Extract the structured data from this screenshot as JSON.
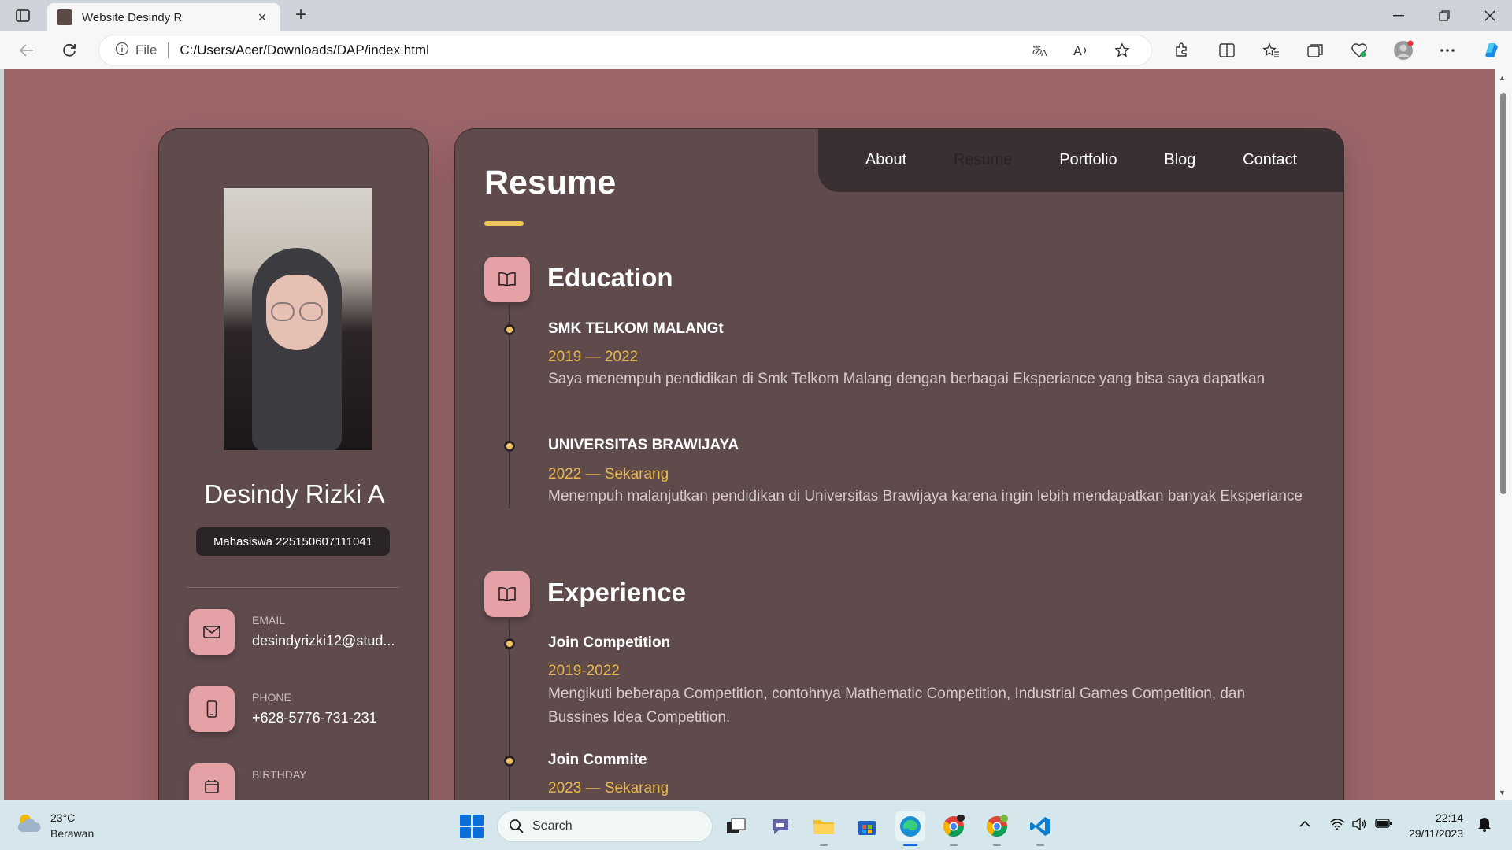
{
  "browser": {
    "tab_title": "Website Desindy R",
    "new_tab_glyph": "+",
    "close_glyph": "×",
    "address_prefix": "File",
    "url": "C:/Users/Acer/Downloads/DAP/index.html",
    "icons": [
      "sidebar-toggle-icon",
      "back-icon",
      "refresh-icon",
      "info-icon",
      "translate-icon",
      "read-aloud-icon",
      "favorite-star-icon",
      "extensions-icon",
      "split-screen-icon",
      "favorites-icon",
      "collections-icon",
      "browser-essentials-icon",
      "profile-icon",
      "more-icon",
      "copilot-icon"
    ]
  },
  "sidebar": {
    "name": "Desindy Rizki A",
    "title": "Mahasiswa 225150607111041",
    "contacts": [
      {
        "label": "EMAIL",
        "value": "desindyrizki12@stud...",
        "icon": "mail-icon"
      },
      {
        "label": "PHONE",
        "value": "+628-5776-731-231",
        "icon": "phone-icon"
      },
      {
        "label": "BIRTHDAY",
        "value": "",
        "icon": "calendar-icon"
      }
    ]
  },
  "nav": {
    "items": [
      "About",
      "Resume",
      "Portfolio",
      "Blog",
      "Contact"
    ],
    "active": "Resume"
  },
  "resume": {
    "title": "Resume",
    "education": {
      "title": "Education",
      "items": [
        {
          "title": "SMK TELKOM MALANGt",
          "date": "2019 — 2022",
          "desc": "Saya menempuh pendidikan di Smk Telkom Malang dengan berbagai Eksperiance yang bisa saya dapatkan"
        },
        {
          "title": "UNIVERSITAS BRAWIJAYA",
          "date": "2022 — Sekarang",
          "desc": "Menempuh malanjutkan pendidikan di Universitas Brawijaya karena ingin lebih mendapatkan banyak Eksperiance"
        }
      ]
    },
    "experience": {
      "title": "Experience",
      "items": [
        {
          "title": "Join Competition",
          "date": "2019-2022",
          "desc": "Mengikuti beberapa Competition, contohnya Mathematic Competition, Industrial Games Competition, dan Bussines Idea Competition."
        },
        {
          "title": "Join Commite",
          "date": "2023 — Sekarang",
          "desc": ""
        }
      ]
    }
  },
  "taskbar": {
    "weather_temp": "23°C",
    "weather_desc": "Berawan",
    "search_label": "Search",
    "time": "22:14",
    "date": "29/11/2023",
    "colors": {
      "accent": "#0a6fd8"
    }
  },
  "colors": {
    "page_bg": "#9c6669",
    "card_bg": "#5f4a4c",
    "nav_bg": "#3a3032",
    "accent_yellow": "#f2c25e",
    "icon_box": "#e4a2a6"
  }
}
